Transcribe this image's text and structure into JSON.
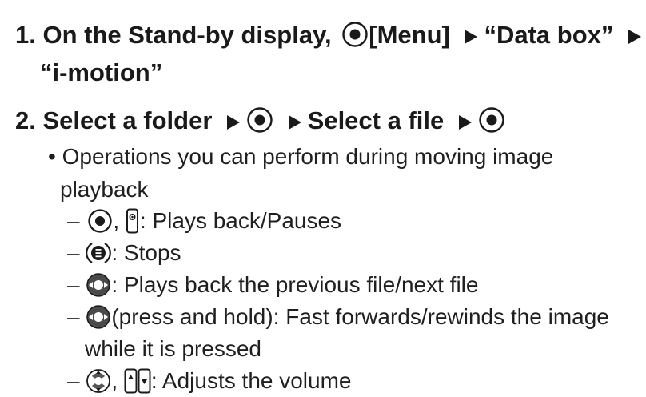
{
  "step1": {
    "number": "1.",
    "text_a": "On the Stand-by display,",
    "text_b": "[Menu]",
    "text_c": "“Data box”",
    "text_d": "“i-motion”"
  },
  "step2": {
    "number": "2.",
    "text_a": "Select a folder",
    "text_b": "Select a file"
  },
  "bullet": {
    "symbol": "•",
    "line1": "Operations you can perform during moving image",
    "line2": "playback"
  },
  "operations": [
    {
      "dash": "–",
      "sep": ",",
      "text": ": Plays back/Pauses"
    },
    {
      "dash": "–",
      "text": ": Stops"
    },
    {
      "dash": "–",
      "text": ": Plays back the previous file/next file"
    },
    {
      "dash": "–",
      "text": "(press and hold): Fast forwards/rewinds the image",
      "text2": "while it is pressed"
    },
    {
      "dash": "–",
      "sep": ",",
      "text": ": Adjusts the volume"
    }
  ],
  "icons": {
    "center_key": "center-select-key-icon",
    "side_key": "side-play-key-icon",
    "clear_key": "clear-key-icon",
    "left_right_key": "navigation-left-right-icon",
    "up_down_key": "navigation-up-down-icon",
    "side_up_down": "side-up-down-keys-icon",
    "arrow": "right-triangle-arrow"
  }
}
